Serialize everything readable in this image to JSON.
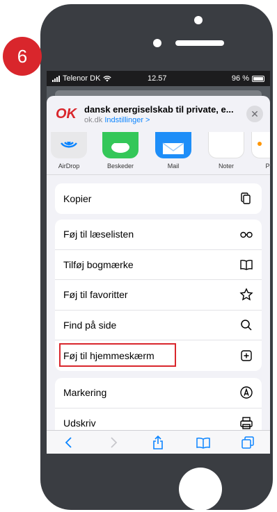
{
  "step_number": "6",
  "status_bar": {
    "carrier": "Telenor DK",
    "time": "12.57",
    "battery": "96 %"
  },
  "share_header": {
    "logo_text": "OK",
    "title": "dansk energiselskab til private, e...",
    "domain": "ok.dk",
    "settings_link": "Indstillinger >"
  },
  "apps": [
    {
      "label": "AirDrop",
      "icon": "airdrop-icon",
      "color": "#e8e8ea"
    },
    {
      "label": "Beskeder",
      "icon": "messages-icon",
      "color": "#34c759"
    },
    {
      "label": "Mail",
      "icon": "mail-icon",
      "color": "#1e8ef8"
    },
    {
      "label": "Noter",
      "icon": "notes-icon",
      "color": "#ffffff"
    },
    {
      "label": "På",
      "icon": "reminders-icon",
      "color": "#ffffff"
    }
  ],
  "actions": {
    "group1": [
      {
        "label": "Kopier",
        "icon": "copy-icon"
      }
    ],
    "group2": [
      {
        "label": "Føj til læselisten",
        "icon": "glasses-icon"
      },
      {
        "label": "Tilføj bogmærke",
        "icon": "book-icon"
      },
      {
        "label": "Føj til favoritter",
        "icon": "star-icon"
      },
      {
        "label": "Find på side",
        "icon": "search-icon"
      },
      {
        "label": "Føj til hjemmeskærm",
        "icon": "add-square-icon",
        "highlighted": true
      }
    ],
    "group3": [
      {
        "label": "Markering",
        "icon": "markup-icon"
      },
      {
        "label": "Udskriv",
        "icon": "print-icon"
      }
    ]
  },
  "colors": {
    "accent_red": "#d9262c",
    "ios_blue": "#0a84ff",
    "phone_body": "#3a3d42"
  }
}
